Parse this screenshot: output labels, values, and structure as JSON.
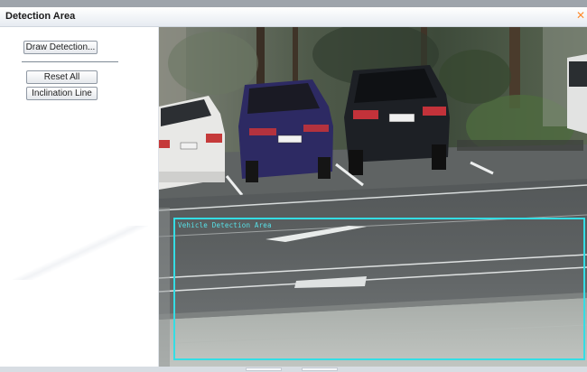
{
  "window": {
    "title": "Detection Area",
    "close_icon": "close-icon"
  },
  "left_panel": {
    "draw_detection_label": "Draw Detection...",
    "reset_all_label": "Reset All",
    "inclination_line_label": "Inclination Line"
  },
  "video": {
    "detection_area_label": "Vehicle Detection Area",
    "detection_area_color": "#34dde4",
    "plates": [
      "",
      "",
      ""
    ]
  },
  "colors": {
    "title_gradient_top": "#ffffff",
    "panel_bg": "#ffffff",
    "accent_close": "#ff8a2a"
  }
}
